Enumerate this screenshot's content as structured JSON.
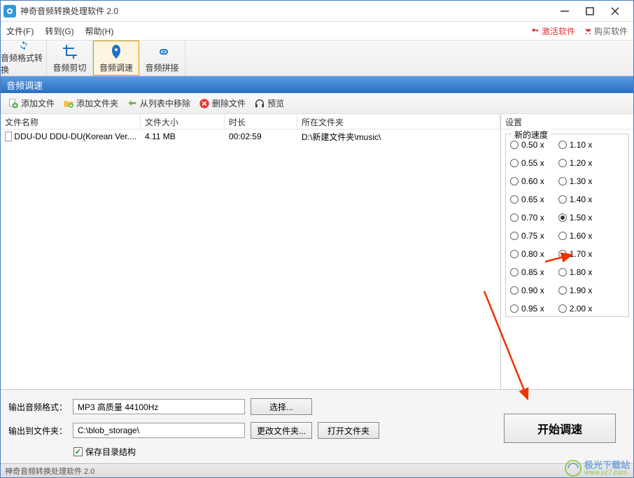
{
  "title": "神奇音频转换处理软件 2.0",
  "menu": {
    "file": "文件(F)",
    "goto": "转到(G)",
    "help": "帮助(H)",
    "activate": "激活软件",
    "buy": "购买软件"
  },
  "toolbar": {
    "convert": "音频格式转换",
    "trim": "音频剪切",
    "speed": "音频调速",
    "join": "音频拼接"
  },
  "section_title": "音频调速",
  "actions": {
    "add_file": "添加文件",
    "add_folder": "添加文件夹",
    "remove": "从列表中移除",
    "delete": "删除文件",
    "preview": "预览"
  },
  "columns": {
    "name": "文件名称",
    "size": "文件大小",
    "duration": "时长",
    "folder": "所在文件夹"
  },
  "rows": [
    {
      "name": "DDU-DU DDU-DU(Korean Ver....",
      "size": "4.11 MB",
      "duration": "00:02:59",
      "folder": "D:\\新建文件夹\\music\\"
    }
  ],
  "settings": {
    "title": "设置",
    "group_label": "新的速度",
    "col1": [
      "0.50 x",
      "0.55 x",
      "0.60 x",
      "0.65 x",
      "0.70 x",
      "0.75 x",
      "0.80 x",
      "0.85 x",
      "0.90 x",
      "0.95 x"
    ],
    "col2": [
      "1.10 x",
      "1.20 x",
      "1.30 x",
      "1.40 x",
      "1.50 x",
      "1.60 x",
      "1.70 x",
      "1.80 x",
      "1.90 x",
      "2.00 x"
    ],
    "selected": "1.50 x"
  },
  "output": {
    "format_label": "输出音频格式：",
    "format_value": "MP3 高质量 44100Hz",
    "choose": "选择...",
    "folder_label": "输出到文件夹：",
    "folder_value": "C:\\blob_storage\\",
    "change": "更改文件夹...",
    "open": "打开文件夹",
    "keep_structure": "保存目录结构"
  },
  "start": "开始调速",
  "status": "神奇音频转换处理软件 2.0",
  "watermark": {
    "t1": "极光下载站",
    "t2": "www.xz7.com"
  }
}
